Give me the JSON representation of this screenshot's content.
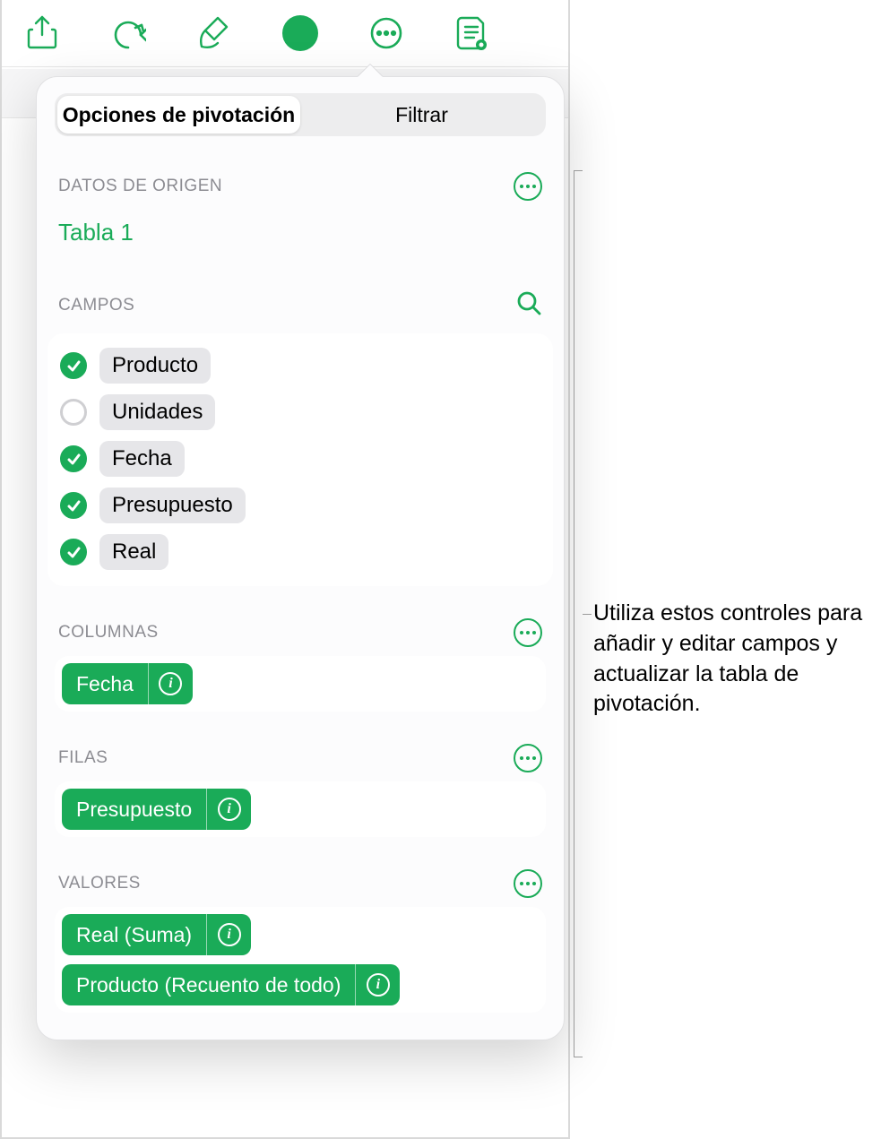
{
  "tabs": {
    "pivot_options": "Opciones de pivotación",
    "filter": "Filtrar"
  },
  "source": {
    "header": "DATOS DE ORIGEN",
    "table_name": "Tabla 1"
  },
  "fields": {
    "header": "CAMPOS",
    "items": [
      {
        "label": "Producto",
        "checked": true
      },
      {
        "label": "Unidades",
        "checked": false
      },
      {
        "label": "Fecha",
        "checked": true
      },
      {
        "label": "Presupuesto",
        "checked": true
      },
      {
        "label": "Real",
        "checked": true
      }
    ]
  },
  "columns": {
    "header": "COLUMNAS",
    "items": [
      {
        "label": "Fecha"
      }
    ]
  },
  "rows": {
    "header": "FILAS",
    "items": [
      {
        "label": "Presupuesto"
      }
    ]
  },
  "values": {
    "header": "VALORES",
    "items": [
      {
        "label": "Real (Suma)"
      },
      {
        "label": "Producto (Recuento de todo)"
      }
    ]
  },
  "callout": "Utiliza estos controles para añadir y editar campos y actualizar la tabla de pivotación."
}
